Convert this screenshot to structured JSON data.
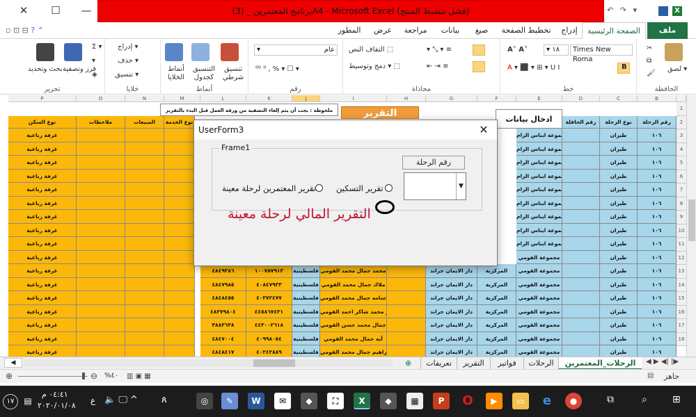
{
  "window": {
    "title": "برنامج المعتمرين _ (3)A4 - Microsoft Excel (فشل تنشيط المنتج)",
    "minimize": "—",
    "maximize": "☐",
    "close": "✕"
  },
  "ribbon_tabs": [
    "ملف",
    "الصفحة الرئيسية",
    "إدراج",
    "تخطيط الصفحة",
    "صيغ",
    "بيانات",
    "مراجعة",
    "عرض",
    "المطور"
  ],
  "ribbon": {
    "groups": [
      "الحافظة",
      "خط",
      "محاذاة",
      "رقم",
      "أنماط",
      "خلايا",
      "تحرير"
    ],
    "paste": "لصق",
    "font_name": "Times New Roma",
    "font_size": "١٨",
    "wrap_text": "التفاف النص",
    "merge_center": "دمج وتوسيط",
    "number_format": "عام",
    "conditional": "تنسيق شرطي",
    "format_table": "التنسيق كجدول",
    "cell_styles": "أنماط الخلايا",
    "insert": "إدراج",
    "delete": "حذف",
    "format": "تنسيق",
    "sort_filter": "فرز وتصفية",
    "find_select": "بحث وتحديد"
  },
  "sheet": {
    "note": "ملحوظة : يجب أن يتم إلغاء التصفية من ورقة العمل قبل البدء بالتقرير",
    "report_banner": "التقرير",
    "data_entry": "ادخال بيانات",
    "headers": {
      "trip_no": "رقم الرحلة",
      "trip_type": "نوع الرحلة",
      "bus_no": "رقم الحافلة",
      "housing_type": "نوع السكن",
      "notes": "ملاحظات",
      "sales": "المبيعات",
      "service_type": "نوع الخدمة"
    },
    "trip_no_value": "١٠٦",
    "trip_type_value": "طيران",
    "housing_value": "غرفة رباعية",
    "group_names": [
      "مجموعة ايناس الرام",
      "مجموعة القومي"
    ],
    "central": "المركزية",
    "dar": "دار الايمان جراند",
    "palestinian": "فلسطينية",
    "rows": [
      {
        "name": "محمد جمال محمد القومي",
        "id": "١٠٠٧٥٧٩١٣",
        "phone": "٤٨٤٩٣٨٦"
      },
      {
        "name": "ملاك جمال محمد القومي",
        "id": "٤٠٨٤٧٩٣٣",
        "phone": "٤٨٤٧٩٨٥"
      },
      {
        "name": "اسامه جمال محمد القومي",
        "id": "٤٠٣٧٢٤٧٧",
        "phone": "٤٨٤٨٤٥٥"
      },
      {
        "name": "عبير محمد شاكر احمد القومي",
        "id": "٤٤٥٨٦٧٤٣١",
        "phone": "٤٨٣٧٩٨٠٤"
      },
      {
        "name": "جمال محمد حسن القومي",
        "id": "٤٤٣٠٠٢٦١٨",
        "phone": "٣٨٨٣٦٣٨"
      },
      {
        "name": "آيه جمال محمد القومي",
        "id": "٤٠٩٩٨٠٥٤",
        "phone": "٤٨٤٧٠٠٤"
      },
      {
        "name": "ابراهيم جمال محمد القومي",
        "id": "٤٠٢٤٢٨٨٩",
        "phone": "٤٨٤٨٤١٧"
      }
    ],
    "row_numbers": [
      "1",
      "2",
      "3",
      "4",
      "5",
      "6",
      "7",
      "8",
      "9",
      "10",
      "11",
      "12",
      "13",
      "14",
      "15",
      "16",
      "17",
      "18"
    ],
    "column_letters": [
      "P",
      "O",
      "N",
      "M",
      "L",
      "K",
      "J",
      "I",
      "H",
      "G",
      "F",
      "E",
      "D",
      "C",
      "B",
      "A"
    ]
  },
  "dialog": {
    "title": "UserForm3",
    "close": "✕",
    "frame": "Frame1",
    "trip_no_label": "رقم الرحلة",
    "option_pilgrims": "تقرير المعتمرين لرحلة معينة",
    "option_housing": "تقرير التسكين",
    "financial_report": "التقرير المالي  لرحلة معينة"
  },
  "sheet_tabs": [
    "الرحلات_المعتمرين",
    "الرحلات",
    "فواتير",
    "التقرير",
    "تعريفات"
  ],
  "status": {
    "ready": "جاهز",
    "zoom": "%٤٠"
  },
  "taskbar": {
    "time": "٠٤:٤١ م",
    "date": "٢٠٢٠/٠١/٠٨",
    "lang": "ع",
    "notifications": "١٧"
  },
  "colors": {
    "title_red": "#ee0000",
    "excel_green": "#217346",
    "cell_yellow": "#fcb80a",
    "cell_blue": "#a8d6ea",
    "report_red": "#c0122e"
  }
}
